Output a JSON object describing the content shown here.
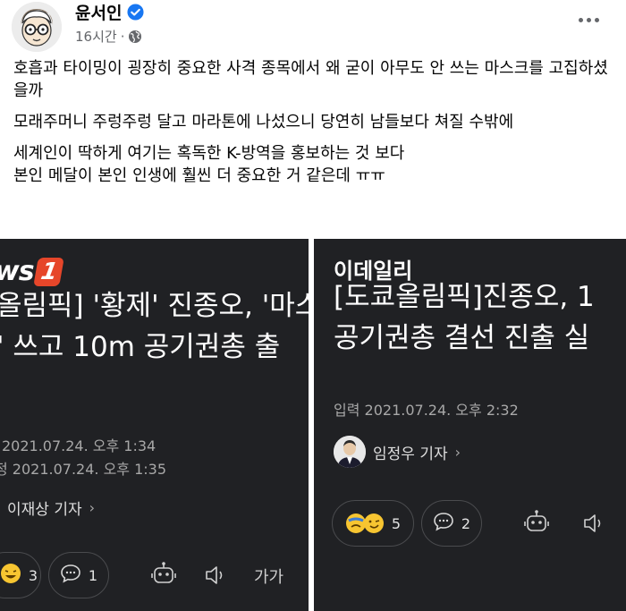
{
  "post": {
    "author": "윤서인",
    "time": "16시간",
    "separator": "·",
    "paragraphs": [
      "호흡과 타이밍이 굉장히 중요한 사격 종목에서 왜 굳이 아무도 안 쓰는 마스크를 고집하셨을까",
      "모래주머니 주렁주렁 달고 마라톤에 나섰으니 당연히 남들보다 쳐질 수밖에",
      "세계인이 딱하게 여기는 혹독한 K-방역을 홍보하는 것 보다",
      "본인 메달이 본인 인생에 훨씬 더 중요한 거 같은데 ㅠㅠ"
    ]
  },
  "left_article": {
    "logo_text": "ws",
    "logo_num": "1",
    "headline_line1": "올림픽] '황제' 진종오, '마스",
    "headline_line2": "' 쓰고 10m 공기권총 출",
    "date1": "2021.07.24. 오후 1:34",
    "date2": "정 2021.07.24. 오후 1:35",
    "reporter": "이재상 기자",
    "reporter_chevron": "›",
    "reaction_count": "3",
    "comment_count": "1",
    "font_label": "가가"
  },
  "right_article": {
    "logo": "이데일리",
    "headline_line1": "[도쿄올림픽]진종오, 1",
    "headline_line2": "공기권총 결선 진출 실",
    "date": "입력 2021.07.24. 오후 2:32",
    "reporter": "임정우 기자",
    "reporter_chevron": "›",
    "reaction_count": "5",
    "comment_count": "2"
  },
  "colors": {
    "article_bg": "#202124",
    "news1_accent": "#e6462a",
    "verified_blue": "#1877f2"
  }
}
